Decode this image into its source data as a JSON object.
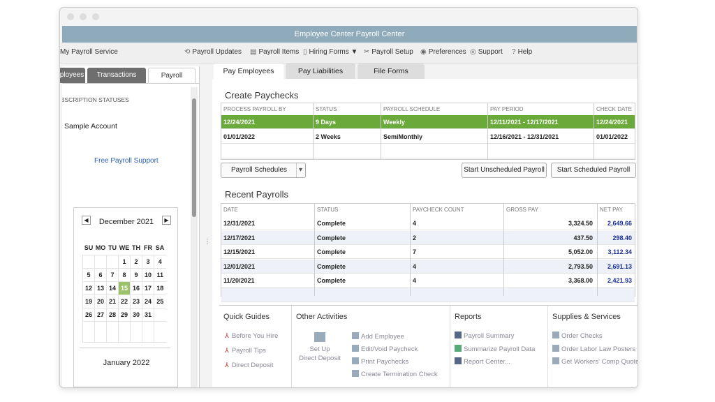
{
  "window": {
    "title": "Employee Center Payroll Center"
  },
  "toolbar": {
    "service": "My Payroll Service",
    "items": [
      "Payroll Updates",
      "Payroll Items",
      "Hiring Forms",
      "Payroll Setup",
      "Preferences",
      "Support",
      "Help"
    ]
  },
  "left": {
    "tabs": [
      "Employees",
      "Transactions",
      "Payroll"
    ],
    "subscription_header": "SUBSCRIPTION STATUSES",
    "account": "Sample Account",
    "support_link": "Free Payroll Support",
    "calendar": {
      "month": "December 2021",
      "next_month": "January 2022",
      "weekdays": [
        "SU",
        "MO",
        "TU",
        "WE",
        "TH",
        "FR",
        "SA"
      ],
      "selected_day": 15,
      "weeks": [
        [
          "",
          "",
          "",
          "1",
          "2",
          "3",
          "4"
        ],
        [
          "5",
          "6",
          "7",
          "8",
          "9",
          "10",
          "11"
        ],
        [
          "12",
          "13",
          "14",
          "15",
          "16",
          "17",
          "18"
        ],
        [
          "19",
          "20",
          "21",
          "22",
          "23",
          "24",
          "25"
        ],
        [
          "26",
          "27",
          "28",
          "29",
          "30",
          "31",
          ""
        ]
      ]
    }
  },
  "main": {
    "tabs": [
      "Pay Employees",
      "Pay Liabilities",
      "File Forms"
    ],
    "create": {
      "title": "Create  Paychecks",
      "columns": [
        "PROCESS PAYROLL BY",
        "STATUS",
        "PAYROLL SCHEDULE",
        "PAY PERIOD",
        "CHECK DATE"
      ],
      "rows": [
        [
          "12/24/2021",
          "9 Days",
          "Weekly",
          "12/11/2021 - 12/17/2021",
          "12/24/2021"
        ],
        [
          "01/01/2022",
          "2 Weeks",
          "SemiMonthly",
          "12/16/2021 - 12/31/2021",
          "01/01/2022"
        ]
      ],
      "schedules_label": "Payroll Schedules",
      "unscheduled": "Start Unscheduled Payroll",
      "scheduled": "Start Scheduled Payroll",
      "highlight": "#6aaa3a"
    },
    "recent": {
      "title": "Recent Payrolls",
      "columns": [
        "DATE",
        "STATUS",
        "PAYCHECK COUNT",
        "GROSS PAY",
        "NET PAY"
      ],
      "rows": [
        [
          "12/31/2021",
          "Complete",
          "4",
          "3,324.50",
          "2,649.66"
        ],
        [
          "12/17/2021",
          "Complete",
          "2",
          "437.50",
          "298.40"
        ],
        [
          "12/15/2021",
          "Complete",
          "7",
          "5,052.00",
          "3,112.34"
        ],
        [
          "12/01/2021",
          "Complete",
          "4",
          "2,793.50",
          "2,691.13"
        ],
        [
          "11/20/2021",
          "Complete",
          "4",
          "3,368.00",
          "2,421.93"
        ]
      ]
    },
    "quick_guides": {
      "title": "Quick Guides",
      "items": [
        "Before  You  Hire",
        "Payroll  Tips",
        "Direct  Deposit"
      ]
    },
    "other": {
      "title": "Other Activities",
      "direct_deposit": "Set Up\nDirect Deposit",
      "items": [
        "Add Employee",
        "Edit/Void Paycheck",
        "Print Paychecks",
        "Create Termination Check"
      ]
    },
    "reports": {
      "title": "Reports",
      "items": [
        "Payroll Summary",
        "Summarize Payroll Data",
        "Report Center..."
      ]
    },
    "supplies": {
      "title": "Supplies & Services",
      "items": [
        "Order Checks",
        "Order Labor Law Posters",
        "Get Workers' Comp Quote"
      ]
    }
  }
}
